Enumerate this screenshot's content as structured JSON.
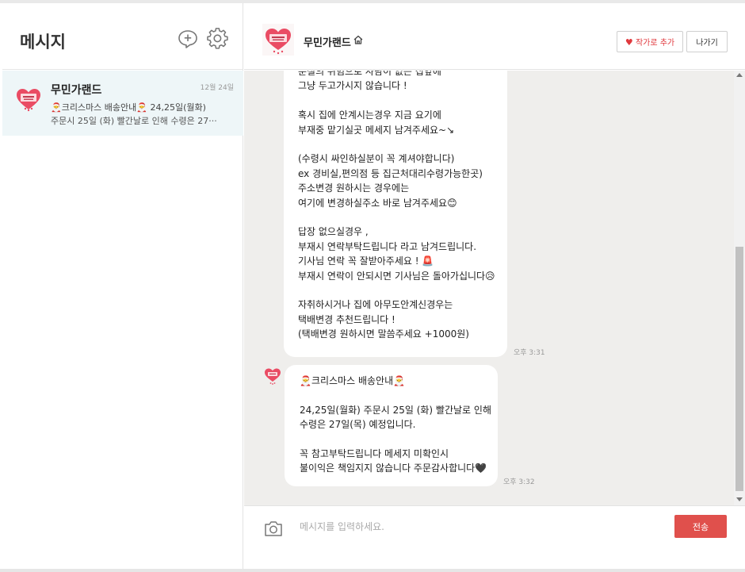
{
  "sidebar": {
    "title": "메시지",
    "conversations": [
      {
        "name": "무민가랜드",
        "date": "12월 24일",
        "preview_line1": "🎅크리스마스 배송안내🎅 24,25일(월화)",
        "preview_line2": "주문시 25일 (화) 빨간날로 인해 수령은 27···"
      }
    ]
  },
  "chat": {
    "name": "무민가랜드",
    "favorite_label": "작가로 추가",
    "leave_label": "나가기",
    "messages": [
      {
        "lines": [
          "분실의 위험으로 사람이 없는 집앞에",
          "그냥 두고가시지 않습니다 !",
          "",
          "혹시 집에 안계시는경우 지금 요기에",
          "부재중 맡기실곳 메세지 남겨주세요~↘",
          "",
          "(수령시 싸인하실분이 꼭 계셔야합니다)",
          "ex 경비실,편의점 등 집근처대리수령가능한곳)",
          "주소변경 원하시는 경우에는",
          "여기에 변경하실주소 바로 남겨주세요😊",
          "",
          "답장 없으실경우 ,",
          "부재시 연락부탁드립니다 라고 남겨드립니다.",
          "기사님 연락 꼭 잘받아주세요 ! 🚨",
          "부재시 연락이 안되시면 기사님은 돌아가십니다😥",
          "",
          "자취하시거나 집에 아무도안계신경우는",
          "택배변경 추천드립니다 !",
          "(택배변경 원하시면 말씀주세요 +1000원)"
        ],
        "time": "오후 3:31"
      },
      {
        "lines": [
          "🎅크리스마스 배송안내🎅",
          "",
          "24,25일(월화) 주문시 25일 (화) 빨간날로 인해",
          "수령은 27일(목) 예정입니다.",
          "",
          "꼭 참고부탁드립니다 메세지 미확인시",
          "불이익은 책임지지 않습니다 주문감사합니다🖤"
        ],
        "time": "오후 3:32"
      }
    ]
  },
  "composer": {
    "placeholder": "메시지를 입력하세요.",
    "send_label": "전송"
  },
  "colors": {
    "accent": "#e0504c",
    "selected_conversation_bg": "#eef6f8",
    "chat_bg": "#efeeec"
  },
  "icons": {
    "compose": "compose-icon",
    "settings": "gear-icon",
    "home": "home-icon",
    "heart": "heart-icon",
    "camera": "camera-icon"
  }
}
